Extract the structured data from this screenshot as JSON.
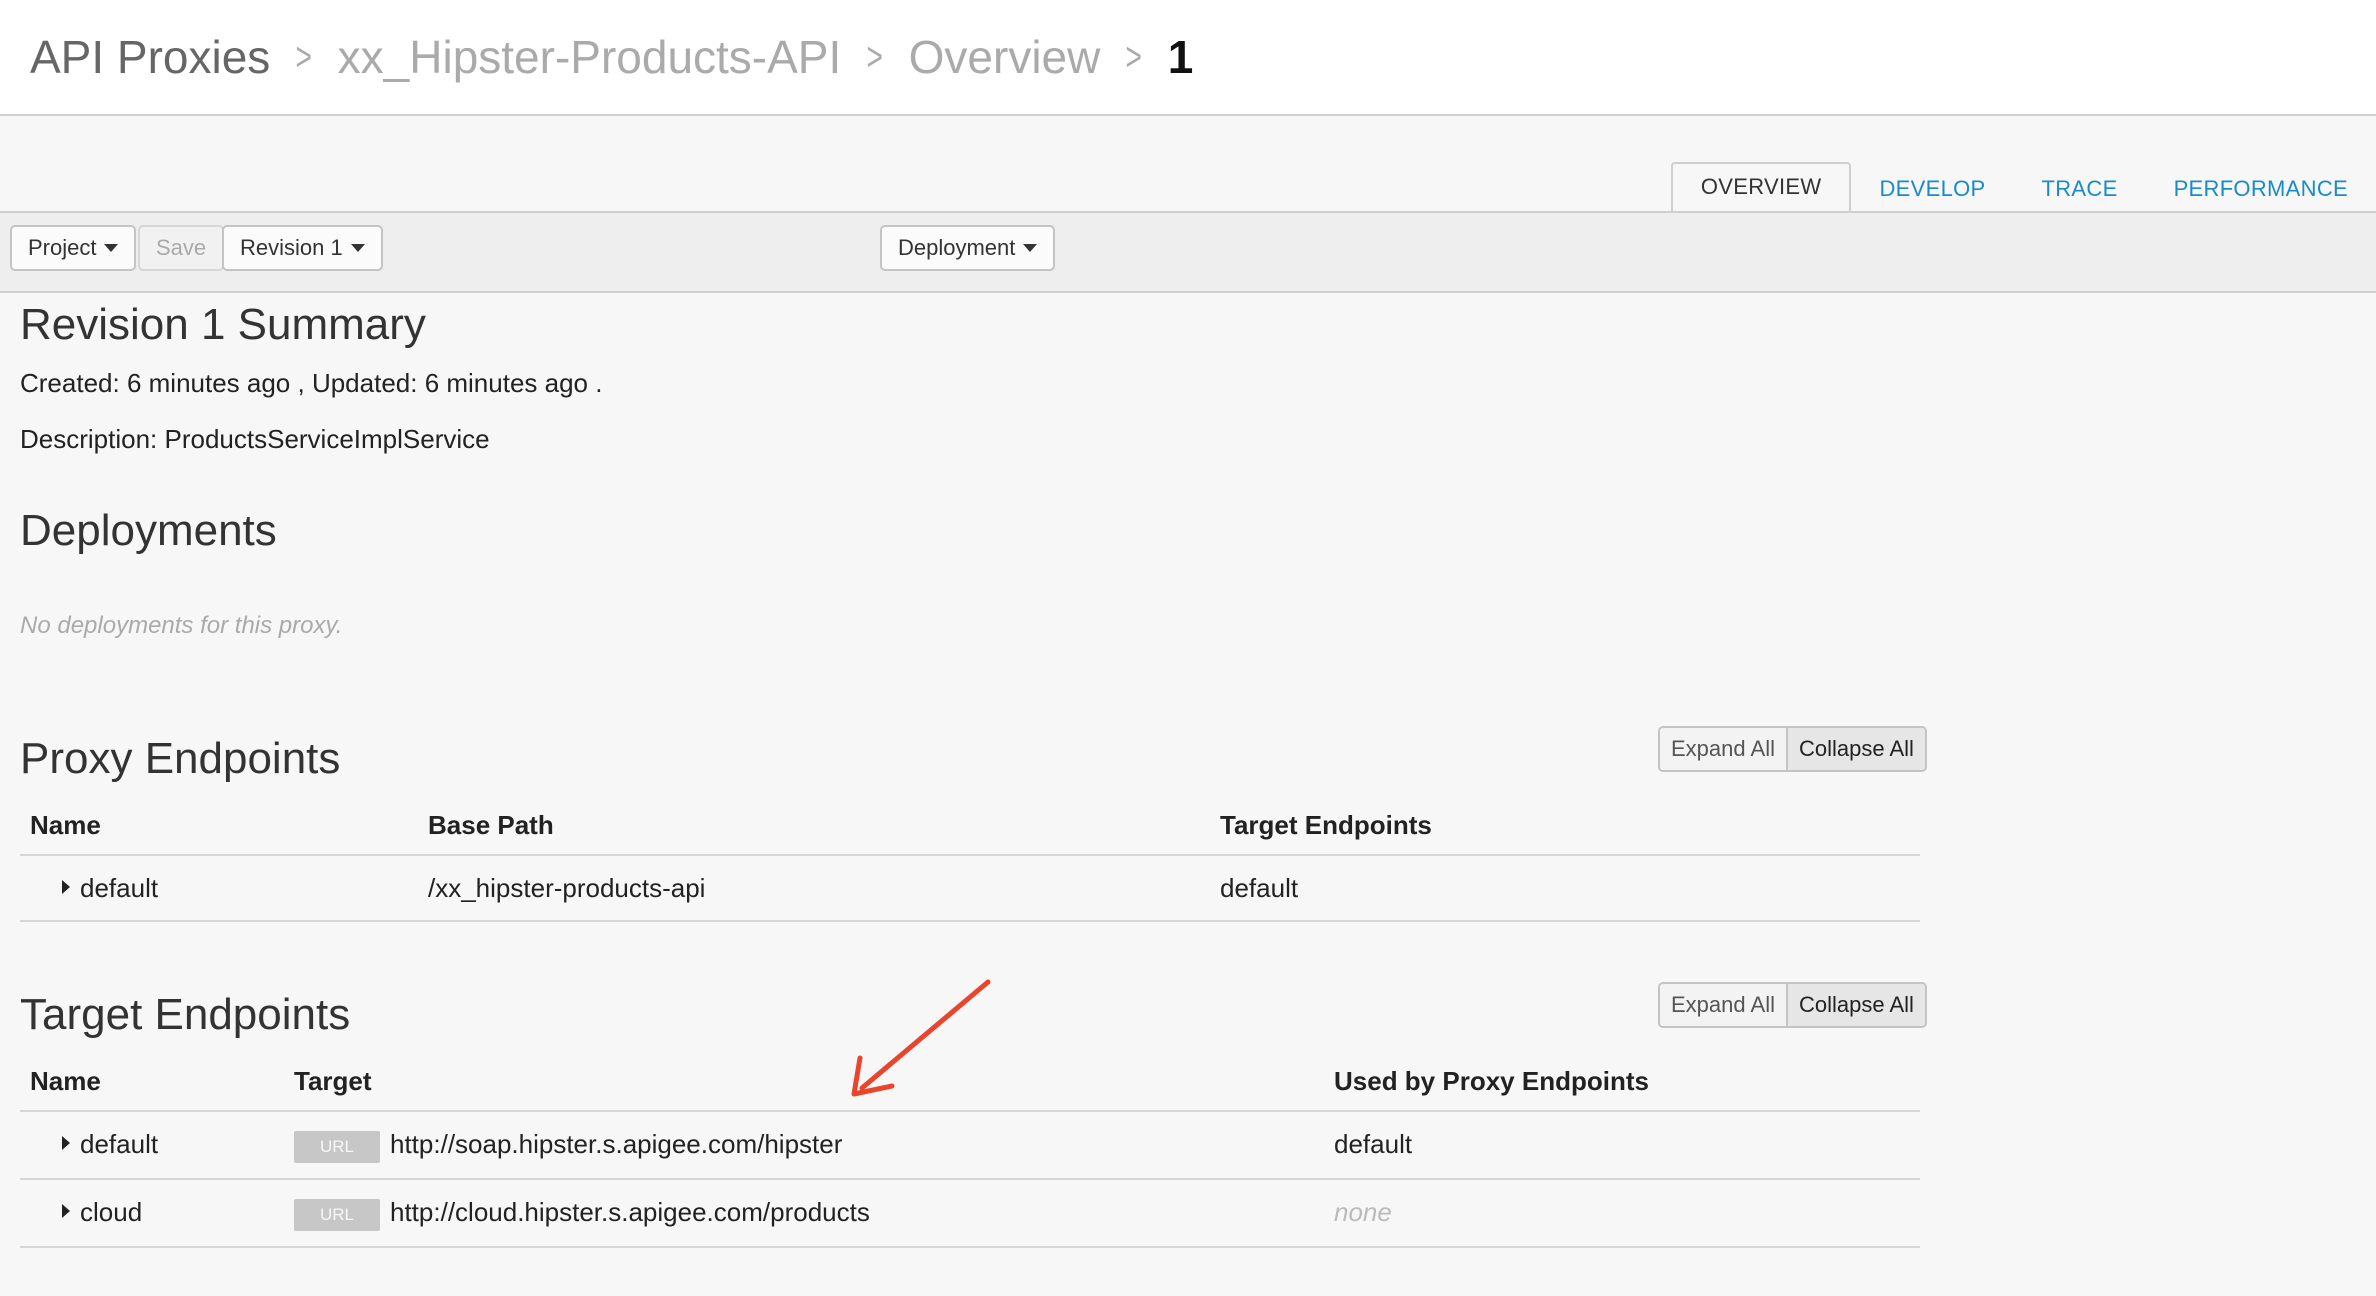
{
  "breadcrumb": {
    "items": [
      "API Proxies",
      "xx_Hipster-Products-API",
      "Overview",
      "1"
    ]
  },
  "tabs": [
    "OVERVIEW",
    "DEVELOP",
    "TRACE",
    "PERFORMANCE"
  ],
  "toolbar": {
    "project_label": "Project",
    "save_label": "Save",
    "revision_label": "Revision 1",
    "deployment_label": "Deployment"
  },
  "summary": {
    "title": "Revision 1 Summary",
    "created_line": "Created: 6 minutes ago , Updated: 6 minutes ago .",
    "description_line": "Description: ProductsServiceImplService"
  },
  "deployments": {
    "title": "Deployments",
    "empty_message": "No deployments for this proxy."
  },
  "proxy_endpoints": {
    "title": "Proxy Endpoints",
    "expand_all": "Expand All",
    "collapse_all": "Collapse All",
    "columns": [
      "Name",
      "Base Path",
      "Target Endpoints"
    ],
    "rows": [
      {
        "name": "default",
        "base_path": "/xx_hipster-products-api",
        "target_endpoints": "default"
      }
    ]
  },
  "target_endpoints": {
    "title": "Target Endpoints",
    "expand_all": "Expand All",
    "collapse_all": "Collapse All",
    "columns": [
      "Name",
      "Target",
      "Used by Proxy Endpoints"
    ],
    "rows": [
      {
        "name": "default",
        "badge": "URL",
        "target": "http://soap.hipster.s.apigee.com/hipster",
        "used_by": "default"
      },
      {
        "name": "cloud",
        "badge": "URL",
        "target": "http://cloud.hipster.s.apigee.com/products",
        "used_by": "none"
      }
    ]
  },
  "colors": {
    "link_blue": "#1a8bc9",
    "annotation_arrow": "#e8452c"
  },
  "icons": {
    "breadcrumb_separator": "chevron-right-icon",
    "dropdown": "caret-down-icon",
    "row_expand": "caret-right-icon",
    "annotation": "arrow-annotation-icon"
  }
}
